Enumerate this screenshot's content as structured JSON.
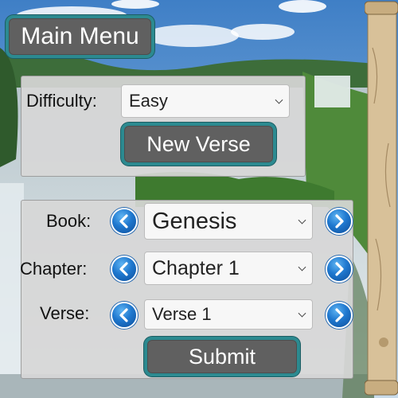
{
  "main_menu": {
    "label": "Main Menu"
  },
  "difficulty": {
    "label": "Difficulty:",
    "selected": "Easy"
  },
  "new_verse": {
    "label": "New Verse"
  },
  "book": {
    "label": "Book:",
    "selected": "Genesis"
  },
  "chapter": {
    "label": "Chapter:",
    "selected": "Chapter 1"
  },
  "verse": {
    "label": "Verse:",
    "selected": "Verse 1"
  },
  "submit": {
    "label": "Submit"
  },
  "icons": {
    "prev": "chevron-left-icon",
    "next": "chevron-right-icon",
    "dropdown": "chevron-down-icon"
  },
  "colors": {
    "button_fill": "#606060",
    "button_border": "#2c8a90",
    "arrow_blue": "#1f78cf"
  }
}
